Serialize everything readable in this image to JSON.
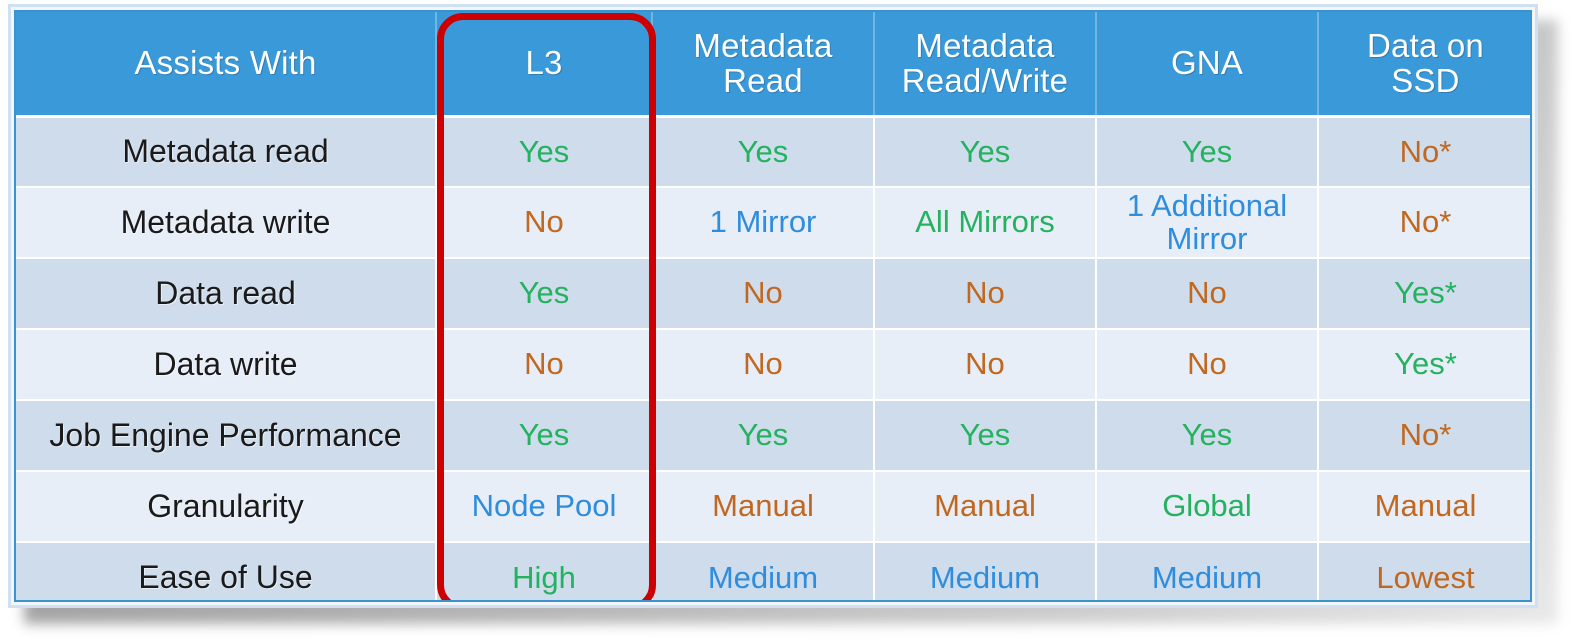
{
  "table": {
    "columns": [
      {
        "id": "assists_with",
        "label": "Assists With"
      },
      {
        "id": "l3",
        "label": "L3"
      },
      {
        "id": "metadata_read",
        "label": "Metadata\nRead",
        "line1": "Metadata",
        "line2": "Read"
      },
      {
        "id": "metadata_read_write",
        "label": "Metadata\nRead/Write",
        "line1": "Metadata",
        "line2": "Read/Write"
      },
      {
        "id": "gna",
        "label": "GNA"
      },
      {
        "id": "data_on_ssd",
        "label": "Data on\nSSD",
        "line1": "Data on",
        "line2": "SSD"
      }
    ],
    "rows": [
      {
        "label": "Metadata read",
        "cells": [
          {
            "text": "Yes",
            "color": "green"
          },
          {
            "text": "Yes",
            "color": "green"
          },
          {
            "text": "Yes",
            "color": "green"
          },
          {
            "text": "Yes",
            "color": "green"
          },
          {
            "text": "No*",
            "color": "orange"
          }
        ]
      },
      {
        "label": "Metadata write",
        "cells": [
          {
            "text": "No",
            "color": "orange"
          },
          {
            "text": "1 Mirror",
            "color": "blue"
          },
          {
            "text": "All Mirrors",
            "color": "green"
          },
          {
            "text": "1 Additional Mirror",
            "color": "blue",
            "line1": "1 Additional",
            "line2": "Mirror"
          },
          {
            "text": "No*",
            "color": "orange"
          }
        ]
      },
      {
        "label": "Data read",
        "cells": [
          {
            "text": "Yes",
            "color": "green"
          },
          {
            "text": "No",
            "color": "orange"
          },
          {
            "text": "No",
            "color": "orange"
          },
          {
            "text": "No",
            "color": "orange"
          },
          {
            "text": "Yes*",
            "color": "green"
          }
        ]
      },
      {
        "label": "Data write",
        "cells": [
          {
            "text": "No",
            "color": "orange"
          },
          {
            "text": "No",
            "color": "orange"
          },
          {
            "text": "No",
            "color": "orange"
          },
          {
            "text": "No",
            "color": "orange"
          },
          {
            "text": "Yes*",
            "color": "green"
          }
        ]
      },
      {
        "label": "Job Engine Performance",
        "cells": [
          {
            "text": "Yes",
            "color": "green"
          },
          {
            "text": "Yes",
            "color": "green"
          },
          {
            "text": "Yes",
            "color": "green"
          },
          {
            "text": "Yes",
            "color": "green"
          },
          {
            "text": "No*",
            "color": "orange"
          }
        ]
      },
      {
        "label": "Granularity",
        "cells": [
          {
            "text": "Node Pool",
            "color": "blue"
          },
          {
            "text": "Manual",
            "color": "orange"
          },
          {
            "text": "Manual",
            "color": "orange"
          },
          {
            "text": "Global",
            "color": "green"
          },
          {
            "text": "Manual",
            "color": "orange"
          }
        ]
      },
      {
        "label": "Ease of Use",
        "cells": [
          {
            "text": "High",
            "color": "green"
          },
          {
            "text": "Medium",
            "color": "blue"
          },
          {
            "text": "Medium",
            "color": "blue"
          },
          {
            "text": "Medium",
            "color": "blue"
          },
          {
            "text": "Lowest",
            "color": "orange"
          }
        ]
      }
    ],
    "highlight": {
      "column_id": "l3",
      "column_label": "L3",
      "color": "#cc0000"
    },
    "colors": {
      "header_background": "#3a99d9",
      "header_text": "#ffffff",
      "row_odd_background": "#cedcec",
      "row_even_background": "#e7eef8",
      "value_green": "#24b25f",
      "value_orange": "#c16820",
      "value_blue": "#2e8ddd",
      "label_text": "#1a1a1a",
      "table_border": "#3a93cf"
    }
  }
}
